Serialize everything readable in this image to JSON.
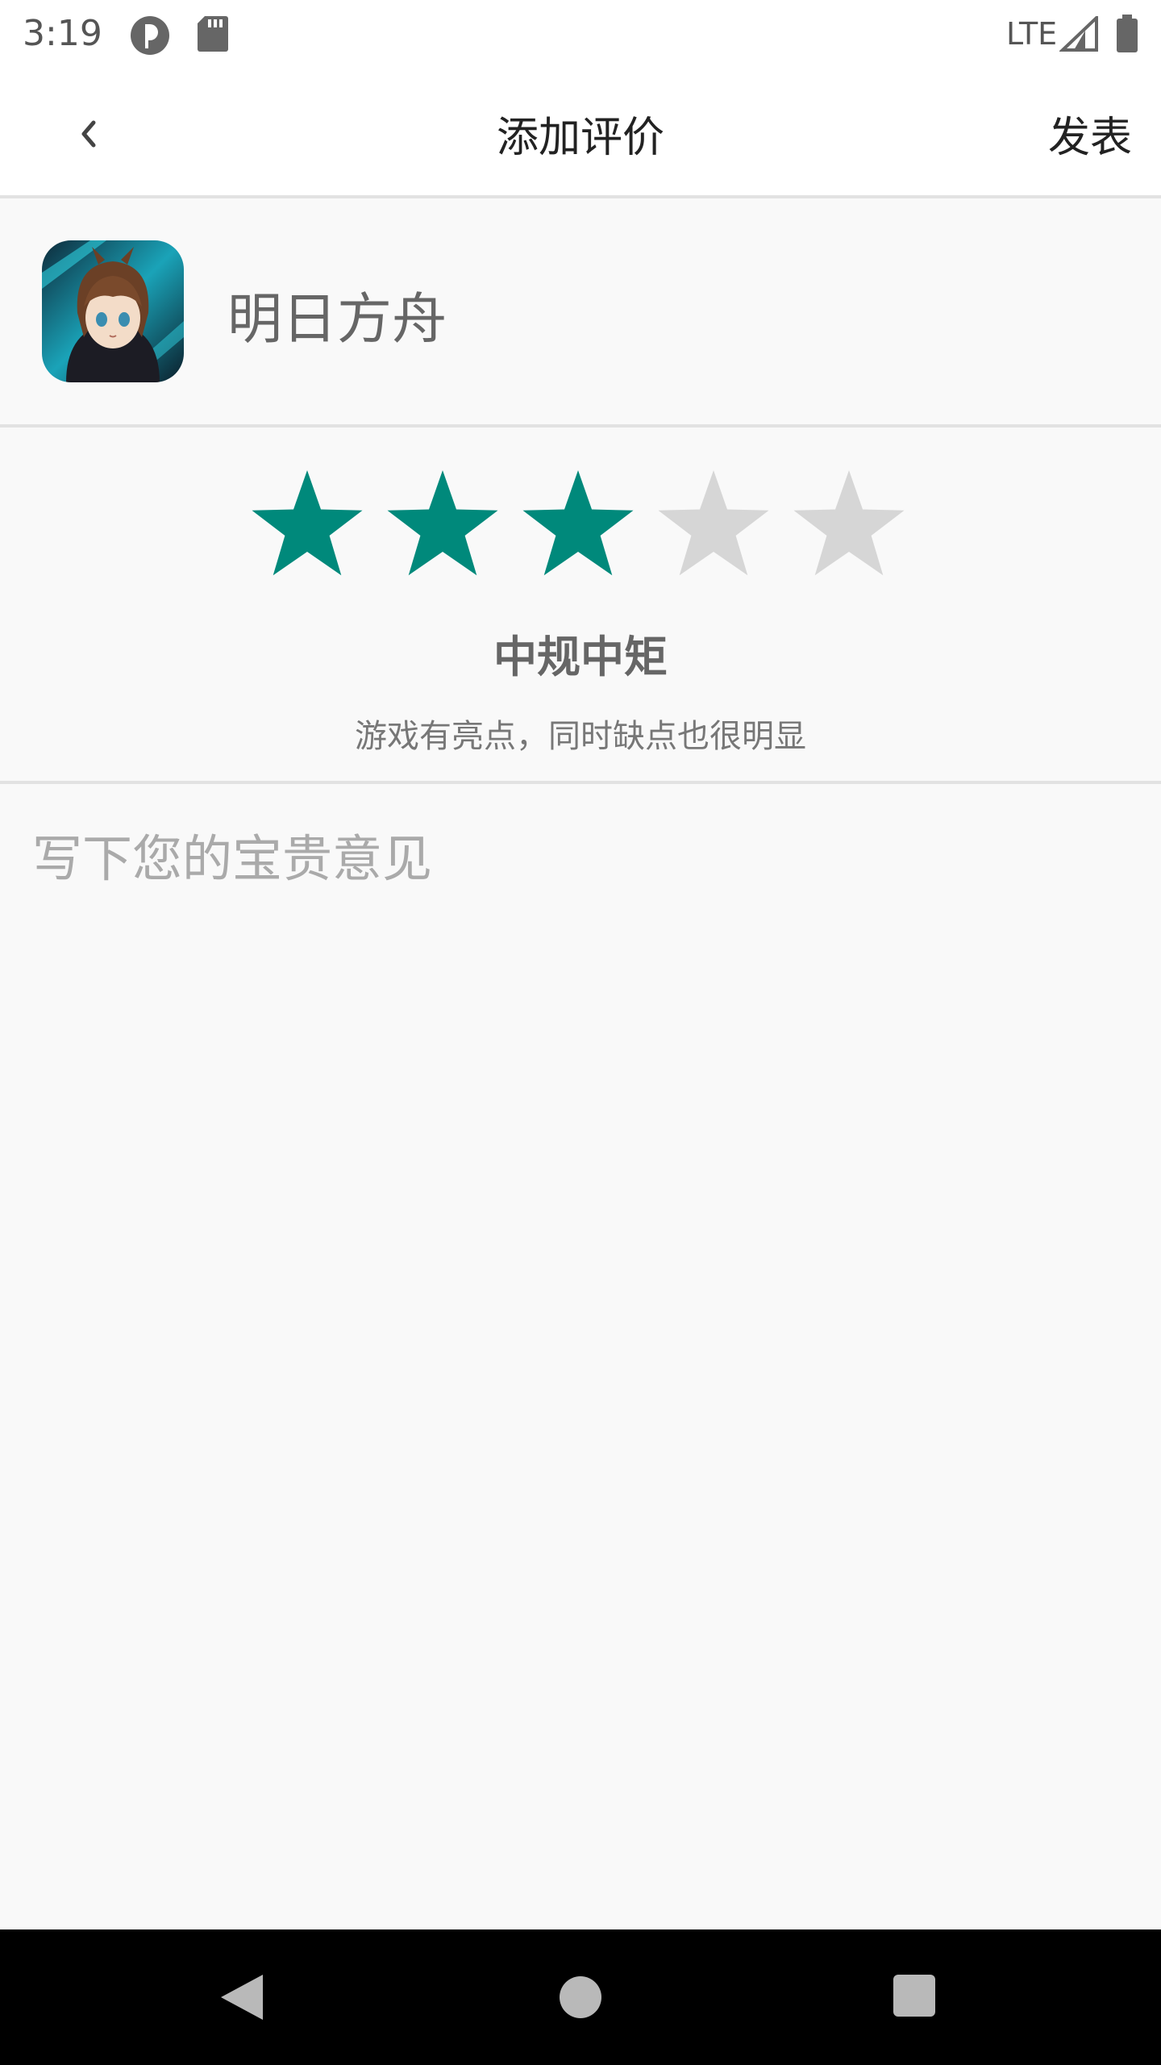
{
  "status_bar": {
    "time": "3:19",
    "network": "LTE",
    "icons": [
      "notification-app-icon",
      "sd-card-icon",
      "signal-icon",
      "battery-icon"
    ]
  },
  "app_bar": {
    "title": "添加评价",
    "publish_label": "发表",
    "back_icon": "chevron-left-icon"
  },
  "app": {
    "name": "明日方舟",
    "icon": "game-app-icon"
  },
  "rating": {
    "value": 3,
    "max": 5,
    "label": "中规中矩",
    "description": "游戏有亮点，同时缺点也很明显",
    "active_color": "#00897b",
    "inactive_color": "#d6d6d6"
  },
  "comment": {
    "placeholder": "写下您的宝贵意见",
    "value": ""
  },
  "nav_bar": {
    "icons": [
      "nav-back-icon",
      "nav-home-icon",
      "nav-recents-icon"
    ]
  }
}
